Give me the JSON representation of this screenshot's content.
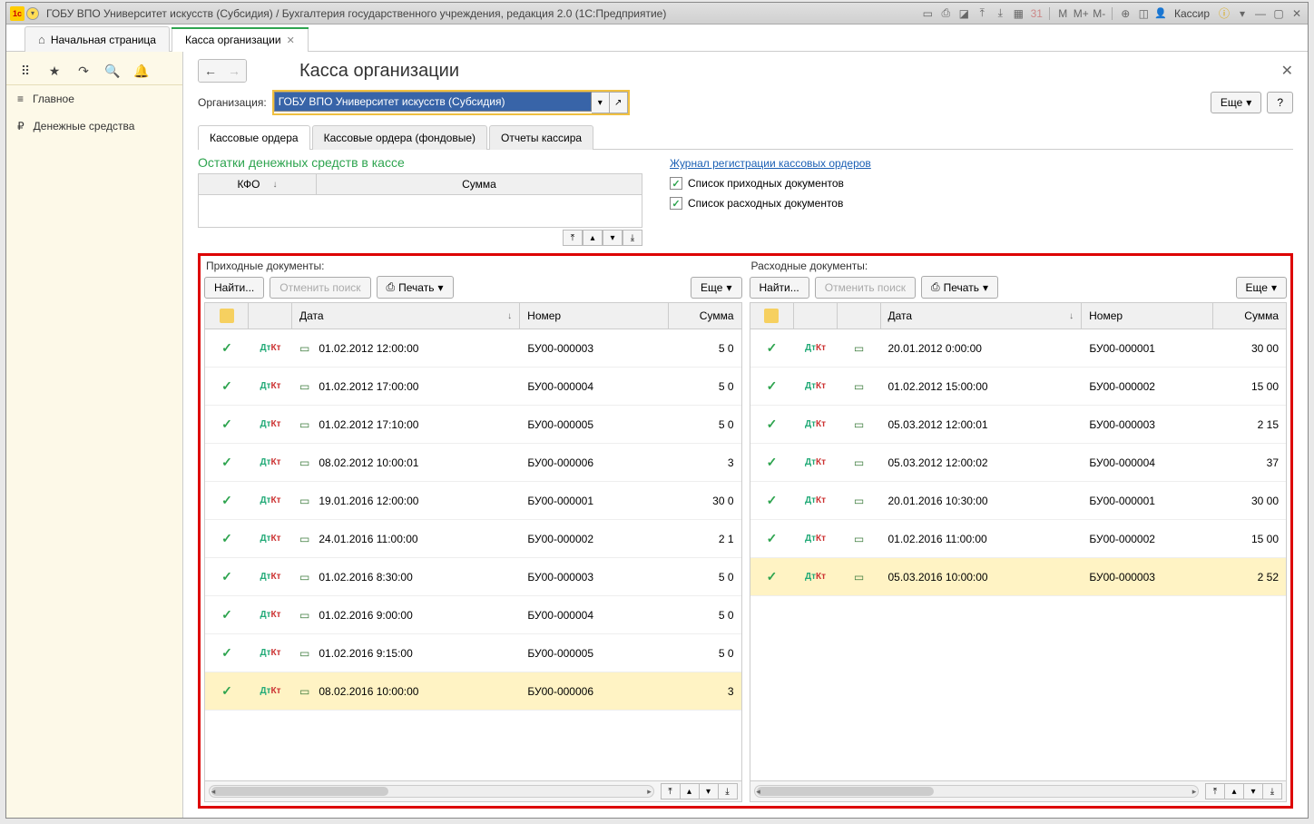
{
  "titlebar": {
    "text": "ГОБУ ВПО Университет искусств (Субсидия) / Бухгалтерия государственного учреждения, редакция 2.0  (1С:Предприятие)",
    "user": "Кассир"
  },
  "tabs": {
    "home": "Начальная страница",
    "active": "Касса организации"
  },
  "sidebar": {
    "main": "Главное",
    "cash": "Денежные средства"
  },
  "page": {
    "title": "Касса организации",
    "org_label": "Организация:",
    "org_value": "ГОБУ ВПО Университет искусств (Субсидия)",
    "more": "Еще",
    "help": "?"
  },
  "inner_tabs": {
    "t1": "Кассовые ордера",
    "t2": "Кассовые ордера (фондовые)",
    "t3": "Отчеты кассира"
  },
  "balances": {
    "title": "Остатки денежных средств в кассе",
    "col1": "КФО",
    "col2": "Сумма",
    "link": "Журнал регистрации кассовых ордеров",
    "chk1": "Список приходных документов",
    "chk2": "Список расходных документов"
  },
  "toolbar": {
    "find": "Найти...",
    "cancel_find": "Отменить поиск",
    "print": "Печать",
    "more": "Еще"
  },
  "panels": {
    "income_title": "Приходные документы:",
    "expense_title": "Расходные документы:"
  },
  "grid_head": {
    "date": "Дата",
    "num": "Номер",
    "sum": "Сумма"
  },
  "income": [
    {
      "date": "01.02.2012 12:00:00",
      "num": "БУ00-000003",
      "sum": "5 0"
    },
    {
      "date": "01.02.2012 17:00:00",
      "num": "БУ00-000004",
      "sum": "5 0"
    },
    {
      "date": "01.02.2012 17:10:00",
      "num": "БУ00-000005",
      "sum": "5 0"
    },
    {
      "date": "08.02.2012 10:00:01",
      "num": "БУ00-000006",
      "sum": "3"
    },
    {
      "date": "19.01.2016 12:00:00",
      "num": "БУ00-000001",
      "sum": "30 0"
    },
    {
      "date": "24.01.2016 11:00:00",
      "num": "БУ00-000002",
      "sum": "2 1"
    },
    {
      "date": "01.02.2016 8:30:00",
      "num": "БУ00-000003",
      "sum": "5 0"
    },
    {
      "date": "01.02.2016 9:00:00",
      "num": "БУ00-000004",
      "sum": "5 0"
    },
    {
      "date": "01.02.2016 9:15:00",
      "num": "БУ00-000005",
      "sum": "5 0"
    },
    {
      "date": "08.02.2016 10:00:00",
      "num": "БУ00-000006",
      "sum": "3"
    }
  ],
  "expense": [
    {
      "date": "20.01.2012 0:00:00",
      "num": "БУ00-000001",
      "sum": "30 00"
    },
    {
      "date": "01.02.2012 15:00:00",
      "num": "БУ00-000002",
      "sum": "15 00"
    },
    {
      "date": "05.03.2012 12:00:01",
      "num": "БУ00-000003",
      "sum": "2 15"
    },
    {
      "date": "05.03.2012 12:00:02",
      "num": "БУ00-000004",
      "sum": "37"
    },
    {
      "date": "20.01.2016 10:30:00",
      "num": "БУ00-000001",
      "sum": "30 00"
    },
    {
      "date": "01.02.2016 11:00:00",
      "num": "БУ00-000002",
      "sum": "15 00"
    },
    {
      "date": "05.03.2016 10:00:00",
      "num": "БУ00-000003",
      "sum": "2 52"
    }
  ],
  "income_selected": 9,
  "expense_selected": 6
}
